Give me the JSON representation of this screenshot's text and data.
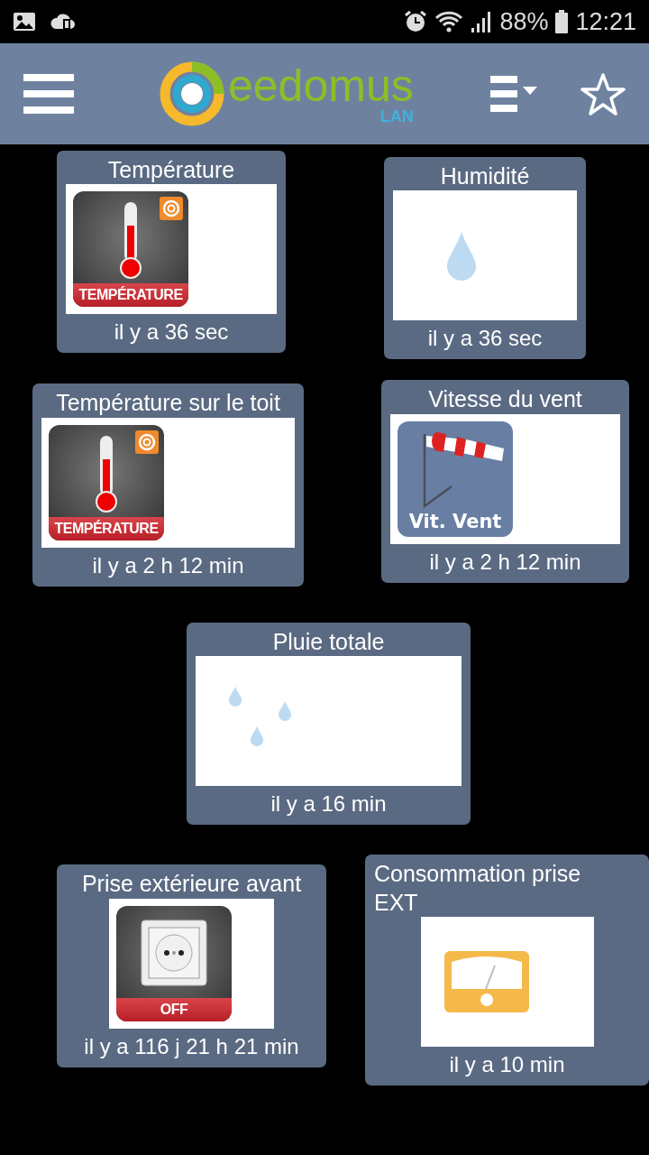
{
  "status_bar": {
    "battery": "88%",
    "time": "12:21"
  },
  "header": {
    "logo": "eedomus",
    "logo_sub": "LAN"
  },
  "widgets": [
    {
      "title": "Température",
      "kind": "thermometer",
      "icon_label": "TEMPÉRATURE",
      "updated": "il y a 36 sec"
    },
    {
      "title": "Humidité",
      "kind": "drop",
      "updated": "il y a 36 sec"
    },
    {
      "title": "Température sur le toit",
      "kind": "thermometer",
      "icon_label": "TEMPÉRATURE",
      "updated": "il y a 2 h 12 min"
    },
    {
      "title": "Vitesse du vent",
      "kind": "windsock",
      "icon_label": "Vit. Vent",
      "updated": "il y a 2 h 12 min"
    },
    {
      "title": "Pluie totale",
      "kind": "rain",
      "updated": "il y a 16 min"
    },
    {
      "title": "Prise extérieure avant",
      "kind": "plug",
      "icon_label": "OFF",
      "updated": "il y a 116 j 21 h 21 min"
    },
    {
      "title": "Consommation prise EXT",
      "kind": "gauge",
      "updated": "il y a 10 min"
    }
  ]
}
